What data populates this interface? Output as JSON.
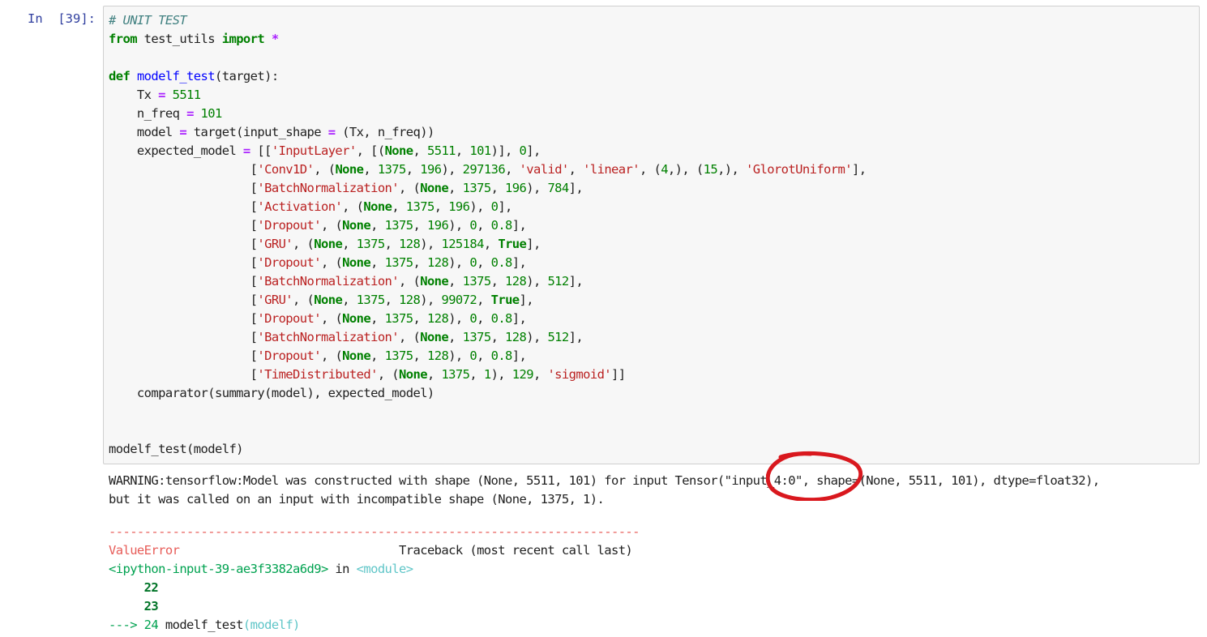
{
  "cell": {
    "prompt": "In  [39]:"
  },
  "code": {
    "l1_comment": "# UNIT TEST",
    "l2_from": "from",
    "l2_mod": " test_utils ",
    "l2_import": "import",
    "l2_star": "*",
    "l4_def": "def",
    "l4_fn": "modelf_test",
    "l4_rest": "(target):",
    "l5_a": "    Tx ",
    "l5_op": "=",
    "l5_num": "5511",
    "l6_a": "    n_freq ",
    "l6_op": "=",
    "l6_num": "101",
    "l7_a": "    model ",
    "l7_op": "=",
    "l7_b": " target(input_shape ",
    "l7_op2": "=",
    "l7_c": " (Tx, n_freq))",
    "l8_a": "    expected_model ",
    "l8_op": "=",
    "l8_b": " [[",
    "l8_s": "'InputLayer'",
    "l8_c": ", [(",
    "l8_none": "None",
    "l8_d": ", ",
    "l8_n1": "5511",
    "l8_e": ", ",
    "l8_n2": "101",
    "l8_f": ")], ",
    "l8_n3": "0",
    "l8_g": "],",
    "layers": [
      [
        "'Conv1D'",
        "(None, 1375, 196), 297136, 'valid', 'linear', (4,), (15,), 'GlorotUniform'],"
      ],
      [
        "'BatchNormalization'",
        "(None, 1375, 196), 784],"
      ],
      [
        "'Activation'",
        "(None, 1375, 196), 0],"
      ],
      [
        "'Dropout'",
        "(None, 1375, 196), 0, 0.8],"
      ],
      [
        "'GRU'",
        "(None, 1375, 128), 125184, True],"
      ],
      [
        "'Dropout'",
        "(None, 1375, 128), 0, 0.8],"
      ],
      [
        "'BatchNormalization'",
        "(None, 1375, 128), 512],"
      ],
      [
        "'GRU'",
        "(None, 1375, 128), 99072, True],"
      ],
      [
        "'Dropout'",
        "(None, 1375, 128), 0, 0.8],"
      ],
      [
        "'BatchNormalization'",
        "(None, 1375, 128), 512],"
      ],
      [
        "'Dropout'",
        "(None, 1375, 128), 0, 0.8],"
      ],
      [
        "'TimeDistributed'",
        "(None, 1375, 1), 129, 'sigmoid']]"
      ]
    ],
    "l21": "    comparator(summary(model), expected_model)",
    "l24": "modelf_test(modelf)"
  },
  "output": {
    "warning_1": "WARNING:tensorflow:Model was constructed with shape (None, 5511, 101) for input Tensor(\"input_4:0\", shape=(None, 5511, 101), dtype=float32),",
    "warning_2": "but it was called on an input with incompatible shape (None, 1375, 1).",
    "tb_rule": "---------------------------------------------------------------------------",
    "tb_error": "ValueError",
    "tb_header_right": "                               Traceback (most recent call last)",
    "tb_src": "<ipython-input-39-ae3f3382a6d9>",
    "tb_in": " in ",
    "tb_module": "<module>",
    "tb_l22": "     22",
    "tb_l23": "     23",
    "tb_arrow": "---> 24 ",
    "tb_call": "modelf_test",
    "tb_paren": "(modelf)"
  },
  "annotation": {
    "circle_color": "#d9181e"
  }
}
